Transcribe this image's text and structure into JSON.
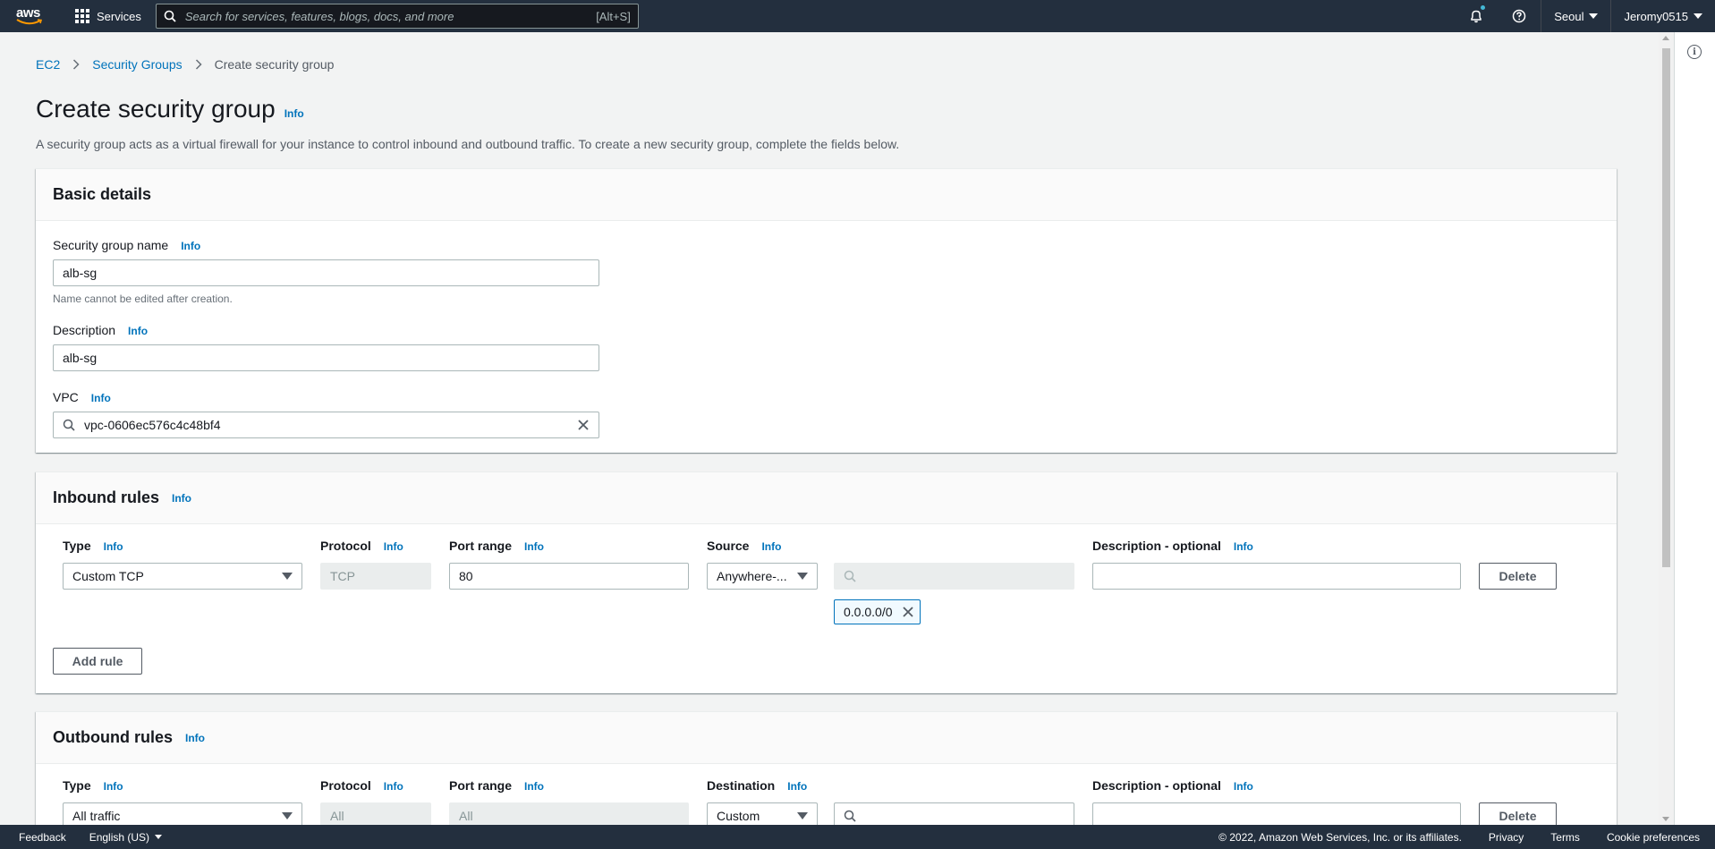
{
  "topnav": {
    "logo": "aws",
    "services_label": "Services",
    "search_placeholder": "Search for services, features, blogs, docs, and more",
    "search_shortcut": "[Alt+S]",
    "region": "Seoul",
    "user": "Jeromy0515",
    "icons": [
      "grid-icon",
      "search-icon",
      "bell-icon",
      "help-icon"
    ]
  },
  "breadcrumb": {
    "items": [
      "EC2",
      "Security Groups",
      "Create security group"
    ]
  },
  "page": {
    "title": "Create security group",
    "info": "Info",
    "description": "A security group acts as a virtual firewall for your instance to control inbound and outbound traffic. To create a new security group, complete the fields below."
  },
  "basic_details": {
    "heading": "Basic details",
    "name_label": "Security group name",
    "name_value": "alb-sg",
    "name_hint": "Name cannot be edited after creation.",
    "description_label": "Description",
    "description_value": "alb-sg",
    "vpc_label": "VPC",
    "vpc_value": "vpc-0606ec576c4c48bf4",
    "info": "Info"
  },
  "inbound": {
    "heading": "Inbound rules",
    "info": "Info",
    "columns": [
      "Type",
      "Protocol",
      "Port range",
      "Source",
      "Description - optional"
    ],
    "rule": {
      "type": "Custom TCP",
      "protocol": "TCP",
      "port_range": "80",
      "source": "Anywhere-...",
      "cidr_token": "0.0.0.0/0",
      "description": ""
    },
    "delete_label": "Delete",
    "add_rule_label": "Add rule"
  },
  "outbound": {
    "heading": "Outbound rules",
    "info": "Info",
    "columns": [
      "Type",
      "Protocol",
      "Port range",
      "Destination",
      "Description - optional"
    ],
    "rule": {
      "type": "All traffic",
      "protocol": "All",
      "port_range": "All",
      "destination": "Custom",
      "description": ""
    },
    "delete_label": "Delete"
  },
  "footer": {
    "feedback": "Feedback",
    "language": "English (US)",
    "copyright": "© 2022, Amazon Web Services, Inc. or its affiliates.",
    "privacy": "Privacy",
    "terms": "Terms",
    "cookie": "Cookie preferences"
  },
  "colors": {
    "nav_bg": "#232f3e",
    "link": "#0073bb",
    "page_bg": "#f2f3f3"
  }
}
